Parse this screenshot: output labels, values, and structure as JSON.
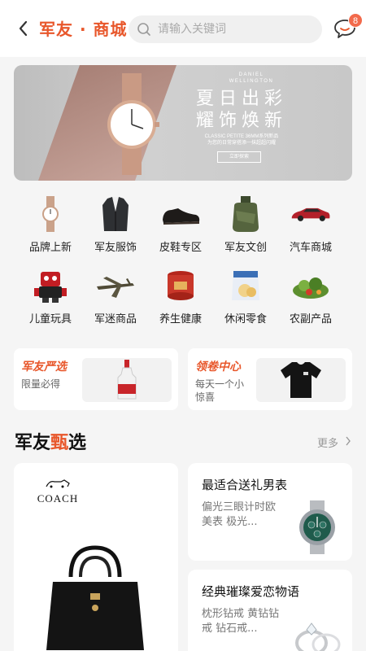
{
  "header": {
    "brand": "军友 · 商城",
    "search_placeholder": "请输入关键词",
    "message_badge": "8"
  },
  "banner": {
    "brand_line1": "DANIEL",
    "brand_line2": "WELLINGTON",
    "title_line1": "夏日出彩",
    "title_line2": "耀饰焕新",
    "subtitle_line1": "CLASSIC PETITE 36MM系列新品",
    "subtitle_line2": "为您的日常穿搭添一抹超超闪耀",
    "button_label": "立即探索"
  },
  "categories": [
    {
      "label": "品牌上新",
      "icon": "watch-icon"
    },
    {
      "label": "军友服饰",
      "icon": "suit-icon"
    },
    {
      "label": "皮鞋专区",
      "icon": "shoe-icon"
    },
    {
      "label": "军友文创",
      "icon": "canteen-icon"
    },
    {
      "label": "汽车商城",
      "icon": "car-icon"
    },
    {
      "label": "儿童玩具",
      "icon": "robot-toy-icon"
    },
    {
      "label": "军迷商品",
      "icon": "bomber-model-icon"
    },
    {
      "label": "养生健康",
      "icon": "tea-can-icon"
    },
    {
      "label": "休闲零食",
      "icon": "snack-bag-icon"
    },
    {
      "label": "农副产品",
      "icon": "vegetables-icon"
    }
  ],
  "promos": [
    {
      "title": "军友严选",
      "subtitle": "限量必得"
    },
    {
      "title": "领卷中心",
      "subtitle": "每天一个小惊喜"
    }
  ],
  "section": {
    "title_part1": "军友",
    "title_highlight": "甄",
    "title_part2": "选",
    "more_label": "更多"
  },
  "featured": {
    "brand_logo": "COACH"
  },
  "products": [
    {
      "title": "最适合送礼男表",
      "desc": "偏光三眼计时欧美表 极光..."
    },
    {
      "title": "经典璀璨爱恋物语",
      "desc": "枕形钻戒 黄钻钻戒 钻石戒..."
    }
  ],
  "colors": {
    "accent": "#e8572b",
    "badge": "#f26a4b",
    "background": "#f5f5f5"
  }
}
